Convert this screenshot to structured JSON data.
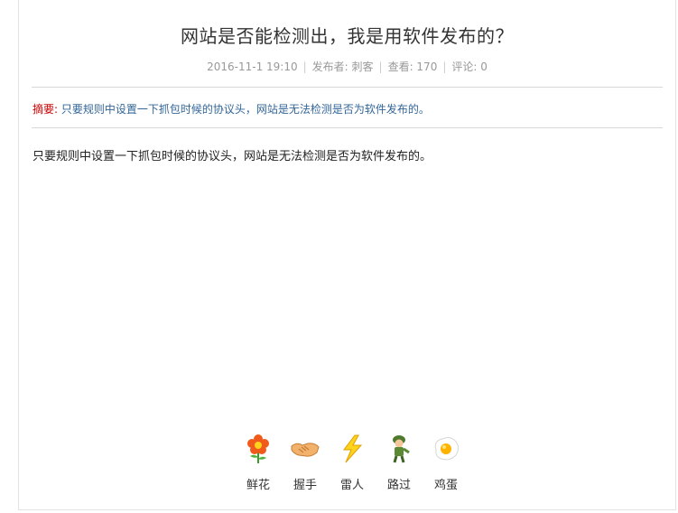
{
  "article": {
    "title": "网站是否能检测出，我是用软件发布的？",
    "meta": {
      "date": "2016-11-1 19:10",
      "author": "发布者: 刺客",
      "views": "查看: 170",
      "comments": "评论: 0"
    },
    "summary_label": "摘要:",
    "summary_text": "只要规则中设置一下抓包时候的协议头，网站是无法检测是否为软件发布的。",
    "body": "只要规则中设置一下抓包时候的协议头，网站是无法检测是否为软件发布的。"
  },
  "reactions": [
    {
      "label": "鲜花",
      "icon": "flower-icon"
    },
    {
      "label": "握手",
      "icon": "handshake-icon"
    },
    {
      "label": "雷人",
      "icon": "lightning-icon"
    },
    {
      "label": "路过",
      "icon": "soldier-icon"
    },
    {
      "label": "鸡蛋",
      "icon": "egg-icon"
    }
  ]
}
